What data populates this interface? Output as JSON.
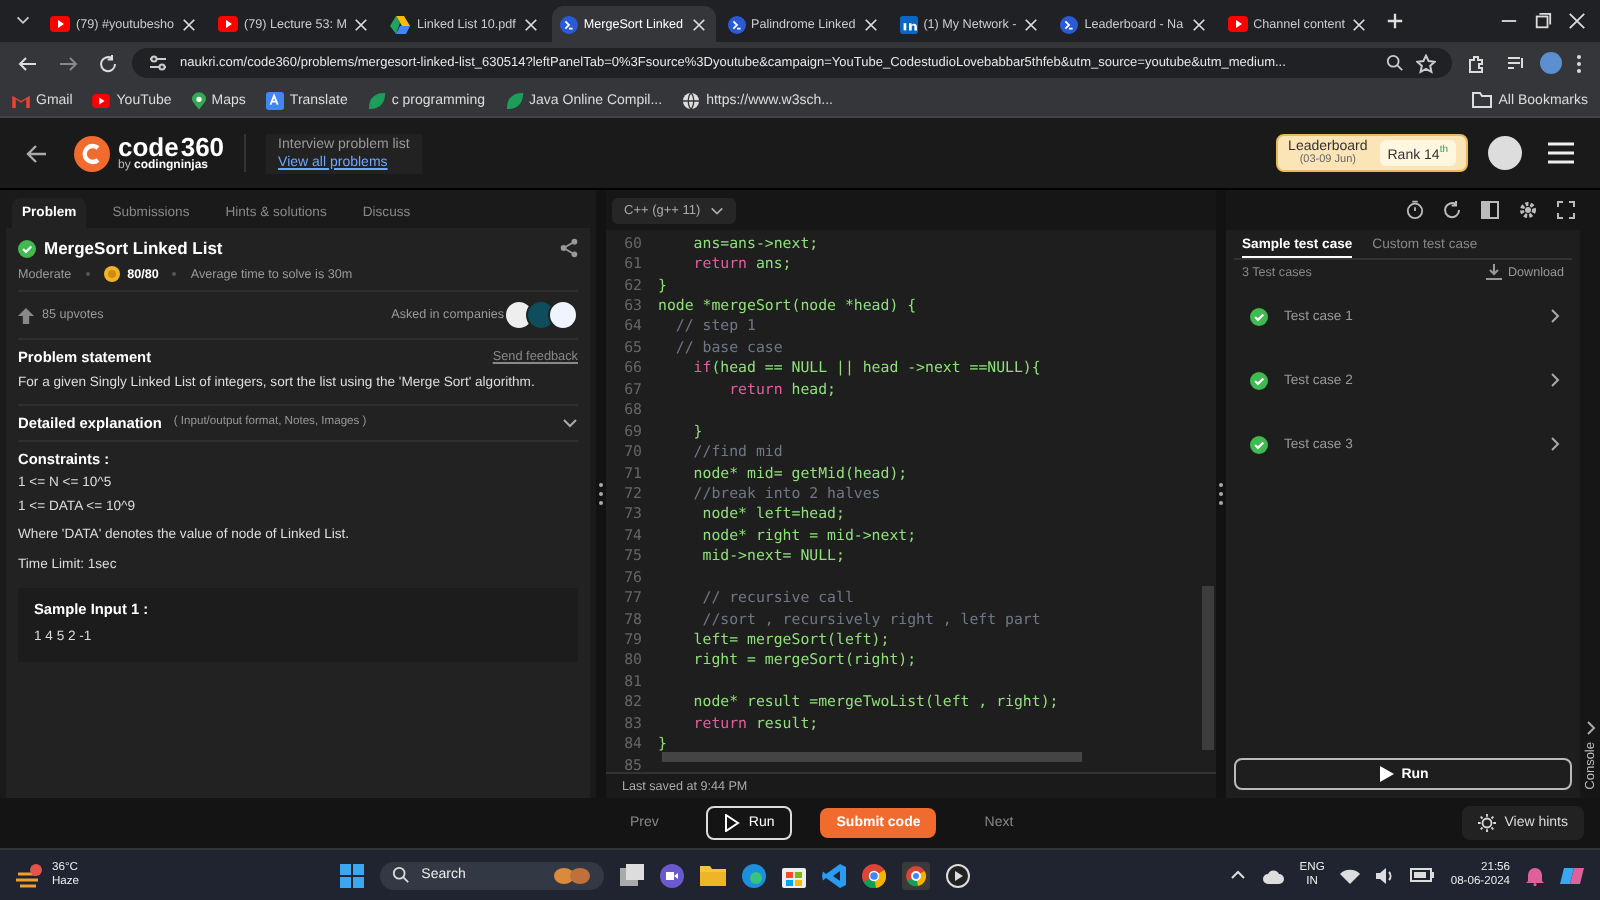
{
  "browser": {
    "tabs": [
      {
        "title": "(79) #youtubesho",
        "kind": "youtube",
        "selected": false
      },
      {
        "title": "(79) Lecture 53: M",
        "kind": "youtube",
        "selected": false
      },
      {
        "title": "Linked List 10.pdf",
        "kind": "drive",
        "selected": false
      },
      {
        "title": "MergeSort Linked",
        "kind": "ninja",
        "selected": true
      },
      {
        "title": "Palindrome Linked",
        "kind": "ninja",
        "selected": false
      },
      {
        "title": "(1) My Network -",
        "kind": "linkedin",
        "selected": false
      },
      {
        "title": "Leaderboard - Na",
        "kind": "ninja",
        "selected": false
      },
      {
        "title": "Channel content",
        "kind": "youtube",
        "selected": false
      }
    ],
    "url": "naukri.com/code360/problems/mergesort-linked-list_630514?leftPanelTab=0%3Fsource%3Dyoutube&campaign=YouTube_CodestudioLovebabbar5thfeb&utm_source=youtube&utm_medium...",
    "bookmarks": [
      {
        "label": "Gmail",
        "kind": "gmail"
      },
      {
        "label": "YouTube",
        "kind": "youtube"
      },
      {
        "label": "Maps",
        "kind": "maps"
      },
      {
        "label": "Translate",
        "kind": "translate"
      },
      {
        "label": "c programming",
        "kind": "leaf"
      },
      {
        "label": "Java Online Compil...",
        "kind": "leaf"
      },
      {
        "label": "https://www.w3sch...",
        "kind": "globe"
      }
    ],
    "all_bookmarks": "All Bookmarks"
  },
  "header": {
    "logo_main": "code",
    "logo_num": "360",
    "logo_by": "by",
    "logo_brand": "codingninjas",
    "list_title": "Interview problem list",
    "list_link": "View all problems",
    "leaderboard": "Leaderboard",
    "leaderboard_dates": "(03-09 Jun)",
    "rank": "Rank 14$^{th}$"
  },
  "problem_tabs": [
    {
      "label": "Problem",
      "selected": true
    },
    {
      "label": "Submissions",
      "selected": false
    },
    {
      "label": "Hints & solutions",
      "selected": false
    },
    {
      "label": "Discuss",
      "selected": false
    }
  ],
  "problem": {
    "solved": true,
    "title": "MergeSort Linked List",
    "difficulty": "Moderate",
    "score": "80/80",
    "avg_time": "Average time to solve is 30m",
    "upvotes": "85 upvotes",
    "asked_in": "Asked in companies",
    "statement_heading": "Problem statement",
    "feedback": "Send feedback",
    "statement": "For a given Singly Linked List of integers, sort the list using the 'Merge Sort' algorithm.",
    "explanation": "Detailed explanation",
    "explanation_note": "( Input/output format, Notes, Images )",
    "constraints_heading": "Constraints :",
    "constraints": [
      "1 <= N <= 10^5",
      "1 <= DATA <= 10^9"
    ],
    "where": "Where 'DATA' denotes the value of node of Linked List.",
    "time_limit": "Time Limit: 1sec",
    "sample_heading": "Sample Input 1 :",
    "sample_input": "1 4 5 2 -1"
  },
  "editor": {
    "language": "C++ (g++ 11)",
    "lines": [
      {
        "number": "60",
        "tokens": [
          {
            "kind": "code",
            "text": "    ans=ans->next;"
          }
        ]
      },
      {
        "number": "61",
        "tokens": [
          {
            "kind": "keyword",
            "text": "    return"
          },
          {
            "kind": "code",
            "text": " ans;"
          }
        ]
      },
      {
        "number": "62",
        "tokens": [
          {
            "kind": "code",
            "text": "}"
          }
        ]
      },
      {
        "number": "63",
        "tokens": [
          {
            "kind": "code",
            "text": "node *mergeSort(node *head) {"
          }
        ]
      },
      {
        "number": "64",
        "tokens": [
          {
            "kind": "comment",
            "text": "  // step 1"
          }
        ]
      },
      {
        "number": "65",
        "tokens": [
          {
            "kind": "comment",
            "text": "  // base case"
          }
        ]
      },
      {
        "number": "66",
        "tokens": [
          {
            "kind": "keyword",
            "text": "    if"
          },
          {
            "kind": "code",
            "text": "(head == NULL || head ->next ==NULL){"
          }
        ]
      },
      {
        "number": "67",
        "tokens": [
          {
            "kind": "keyword",
            "text": "        return"
          },
          {
            "kind": "code",
            "text": " head;"
          }
        ]
      },
      {
        "number": "68"
      },
      {
        "number": "69",
        "tokens": [
          {
            "kind": "code",
            "text": "    }"
          }
        ]
      },
      {
        "number": "70",
        "tokens": [
          {
            "kind": "comment",
            "text": "    //find mid"
          }
        ]
      },
      {
        "number": "71",
        "tokens": [
          {
            "kind": "code",
            "text": "    node* mid= getMid(head);"
          }
        ]
      },
      {
        "number": "72",
        "tokens": [
          {
            "kind": "comment",
            "text": "    //break into 2 halves"
          }
        ]
      },
      {
        "number": "73",
        "tokens": [
          {
            "kind": "code",
            "text": "     node* left=head;"
          }
        ]
      },
      {
        "number": "74",
        "tokens": [
          {
            "kind": "code",
            "text": "     node* right = mid->next;"
          }
        ]
      },
      {
        "number": "75",
        "tokens": [
          {
            "kind": "code",
            "text": "     mid->next= NULL;"
          }
        ]
      },
      {
        "number": "76"
      },
      {
        "number": "77",
        "tokens": [
          {
            "kind": "comment",
            "text": "     // recursive call"
          }
        ]
      },
      {
        "number": "78",
        "tokens": [
          {
            "kind": "comment",
            "text": "     //sort , recursively right , left part"
          }
        ]
      },
      {
        "number": "79",
        "tokens": [
          {
            "kind": "code",
            "text": "    left= mergeSort(left);"
          }
        ]
      },
      {
        "number": "80",
        "tokens": [
          {
            "kind": "code",
            "text": "    right = mergeSort(right);"
          }
        ]
      },
      {
        "number": "81"
      },
      {
        "number": "82",
        "tokens": [
          {
            "kind": "code",
            "text": "    node* result =mergeTwoList(left , right);"
          }
        ]
      },
      {
        "number": "83",
        "tokens": [
          {
            "kind": "keyword",
            "text": "    return"
          },
          {
            "kind": "code",
            "text": " result;"
          }
        ]
      },
      {
        "number": "84",
        "tokens": [
          {
            "kind": "code",
            "text": "}"
          }
        ]
      },
      {
        "number": "85"
      }
    ],
    "saved": "Last saved at 9:44 PM"
  },
  "test_tabs": [
    {
      "label": "Sample test case",
      "selected": true
    },
    {
      "label": "Custom test case",
      "selected": false
    }
  ],
  "tests": {
    "count": "3 Test cases",
    "download": "Download",
    "cases": [
      {
        "label": "Test case 1",
        "passed": true
      },
      {
        "label": "Test case 2",
        "passed": true
      },
      {
        "label": "Test case 3",
        "passed": true
      }
    ],
    "run": "Run",
    "console": "Console"
  },
  "footer": {
    "prev": "Prev",
    "run": "Run",
    "submit": "Submit code",
    "next": "Next",
    "hints": "View hints"
  },
  "taskbar": {
    "temperature": "36°C",
    "weather": "Haze",
    "search": "Search",
    "lang": "ENG",
    "region": "IN",
    "time": "21:56",
    "date": "08-06-2024"
  }
}
